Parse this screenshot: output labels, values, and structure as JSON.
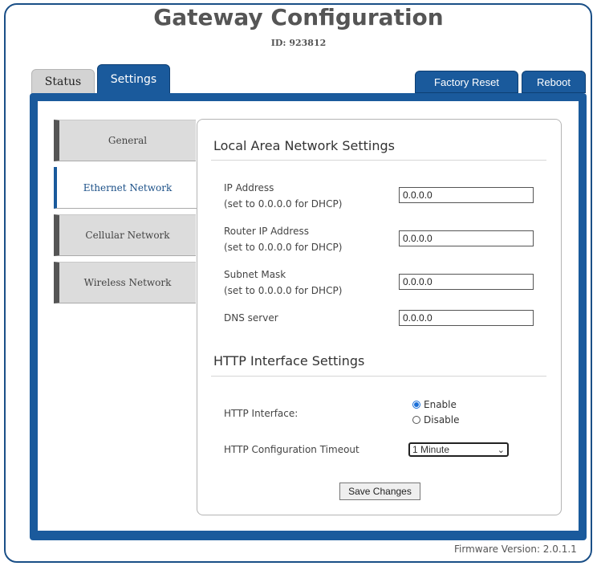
{
  "header": {
    "title": "Gateway Configuration",
    "id_text": "ID: 923812"
  },
  "tabs": [
    {
      "label": "Status"
    },
    {
      "label": "Settings"
    }
  ],
  "actions": {
    "factory_reset": "Factory Reset",
    "reboot": "Reboot"
  },
  "sidebar": {
    "items": [
      {
        "label": "General"
      },
      {
        "label": "Ethernet Network"
      },
      {
        "label": "Cellular Network"
      },
      {
        "label": "Wireless Network"
      }
    ]
  },
  "lan": {
    "title": "Local Area Network Settings",
    "ip": {
      "label": "IP Address",
      "hint": "(set to 0.0.0.0 for DHCP)",
      "value": "0.0.0.0"
    },
    "router": {
      "label": "Router IP Address",
      "hint": "(set to 0.0.0.0 for DHCP)",
      "value": "0.0.0.0"
    },
    "subnet": {
      "label": "Subnet Mask",
      "hint": "(set to 0.0.0.0 for DHCP)",
      "value": "0.0.0.0"
    },
    "dns": {
      "label": "DNS server",
      "value": "0.0.0.0"
    }
  },
  "http": {
    "title": "HTTP Interface Settings",
    "interface_label": "HTTP Interface:",
    "enable": "Enable",
    "disable": "Disable",
    "timeout_label": "HTTP Configuration Timeout",
    "timeout_value": "1 Minute"
  },
  "save_label": "Save Changes",
  "footer": {
    "firmware": "Firmware Version: 2.0.1.1"
  },
  "colors": {
    "accent": "#1a5a9c",
    "radio": "#1a6fd8"
  }
}
